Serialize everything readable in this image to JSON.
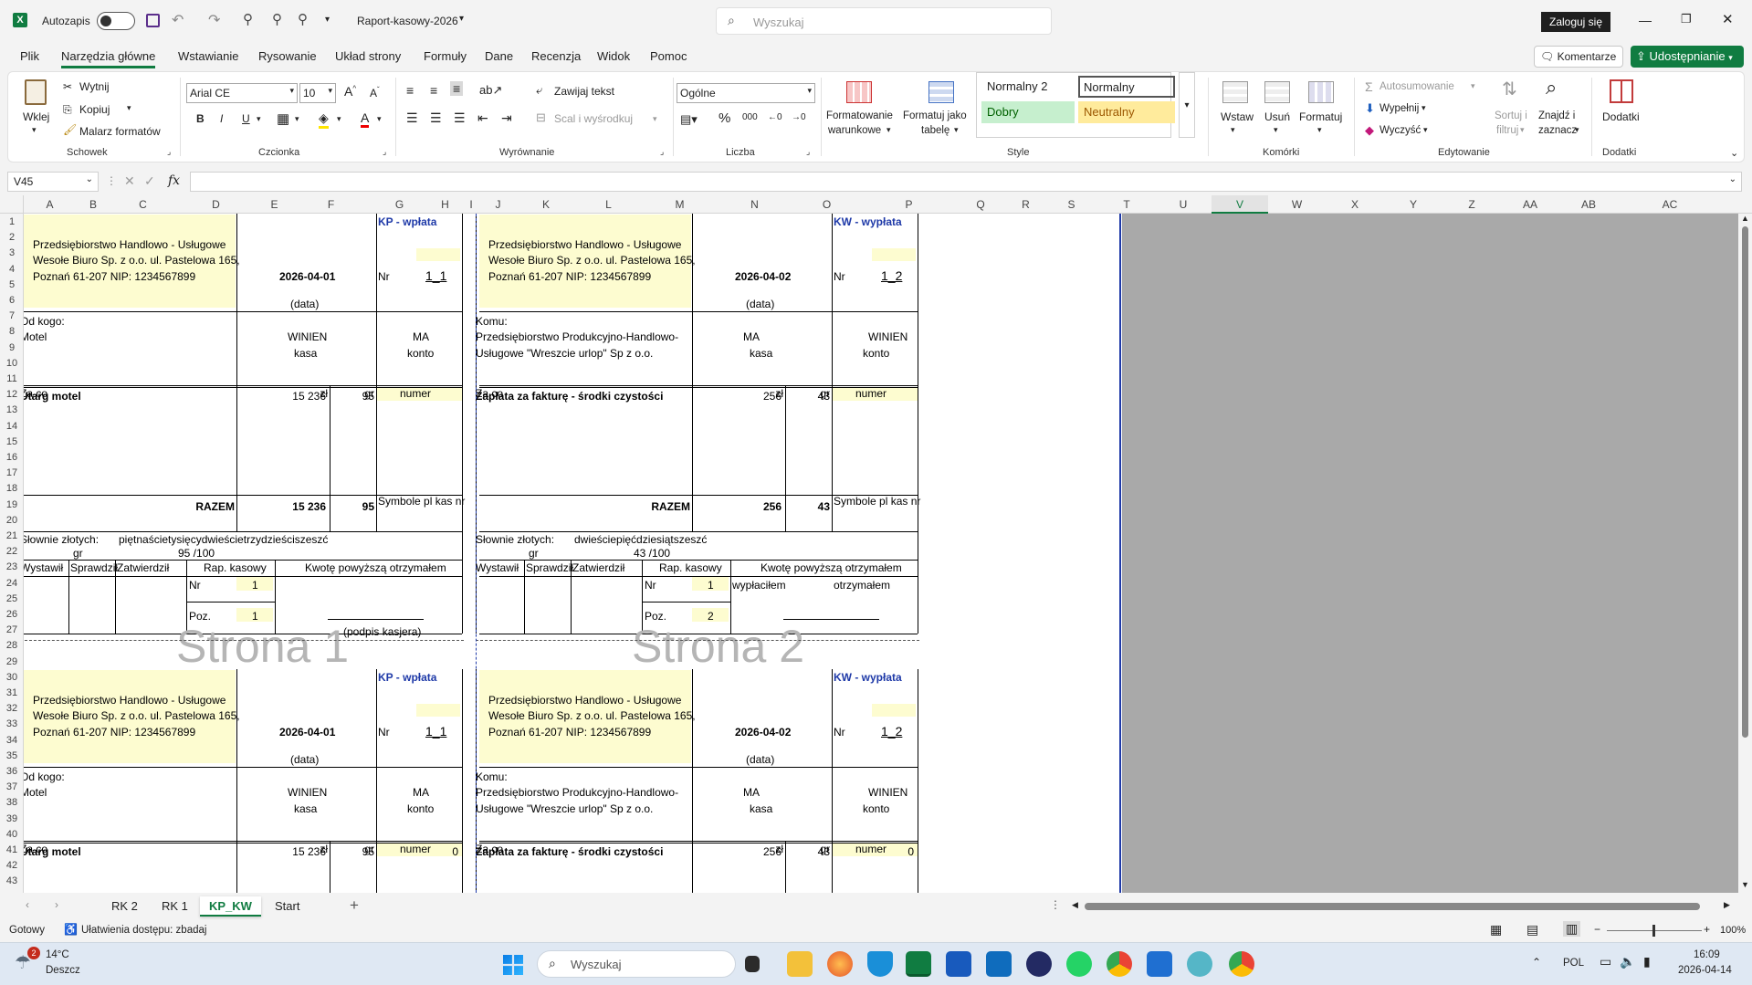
{
  "titlebar": {
    "autosave_label": "Autozapis",
    "doc_title": "Raport-kasowy-2026",
    "search_placeholder": "Wyszukaj",
    "signin_label": "Zaloguj się"
  },
  "menu": {
    "items": [
      "Plik",
      "Narzędzia główne",
      "Wstawianie",
      "Rysowanie",
      "Układ strony",
      "Formuły",
      "Dane",
      "Recenzja",
      "Widok",
      "Pomoc"
    ],
    "active": "Narzędzia główne",
    "comments_label": "Komentarze",
    "share_label": "Udostępnianie"
  },
  "ribbon": {
    "clipboard": {
      "paste": "Wklej",
      "cut": "Wytnij",
      "copy": "Kopiuj",
      "painter": "Malarz formatów",
      "group": "Schowek"
    },
    "font": {
      "name": "Arial CE",
      "size": "10",
      "group": "Czcionka",
      "bold": "B",
      "italic": "I",
      "underline": "U"
    },
    "alignment": {
      "wrap": "Zawijaj tekst",
      "merge": "Scal i wyśrodkuj",
      "group": "Wyrównanie"
    },
    "number": {
      "format": "Ogólne",
      "percent": "%",
      "thousands": "000",
      "group": "Liczba"
    },
    "styles": {
      "cond_format_1": "Formatowanie",
      "cond_format_2": "warunkowe",
      "table_1": "Formatuj jako",
      "table_2": "tabelę",
      "normal2": "Normalny 2",
      "normal": "Normalny",
      "good": "Dobry",
      "neutral": "Neutralny",
      "group": "Style"
    },
    "cells": {
      "insert": "Wstaw",
      "delete": "Usuń",
      "format": "Formatuj",
      "group": "Komórki"
    },
    "editing": {
      "autosum": "Autosumowanie",
      "fill": "Wypełnij",
      "clear": "Wyczyść",
      "sort_1": "Sortuj i",
      "sort_2": "filtruj",
      "find_1": "Znajdź i",
      "find_2": "zaznacz",
      "group": "Edytowanie"
    },
    "addins": {
      "label": "Dodatki",
      "group": "Dodatki"
    }
  },
  "formula_bar": {
    "name_box": "V45",
    "fx": "fx",
    "value": ""
  },
  "columns": [
    "A",
    "B",
    "C",
    "D",
    "E",
    "F",
    "G",
    "H",
    "I",
    "J",
    "K",
    "L",
    "M",
    "N",
    "O",
    "P",
    "Q",
    "R",
    "S",
    "T",
    "U",
    "V",
    "W",
    "X",
    "Y",
    "Z",
    "AA",
    "AB",
    "AC",
    "A"
  ],
  "rows": [
    "1",
    "2",
    "3",
    "4",
    "5",
    "6",
    "7",
    "8",
    "9",
    "10",
    "11",
    "12",
    "13",
    "14",
    "15",
    "16",
    "17",
    "18",
    "19",
    "20",
    "21",
    "22",
    "23",
    "24",
    "25",
    "26",
    "27",
    "28",
    "29",
    "30",
    "31",
    "32",
    "33",
    "34",
    "35",
    "36",
    "37",
    "38",
    "39",
    "40",
    "41",
    "42",
    "43"
  ],
  "vouchers": {
    "kp": {
      "company_1": "Przedsiębiorstwo Handlowo - Usługowe",
      "company_2": "Wesołe Biuro Sp. z o.o. ul. Pastelowa 165,",
      "company_3": "Poznań 61-207 NIP: 1234567899",
      "date": "2026-04-01",
      "date_label": "(data)",
      "type": "KP - wpłata",
      "nr_label": "Nr",
      "nr_value": "1_1",
      "party_label": "Od kogo:",
      "party_1": "Motel",
      "party_2": "",
      "debit_1": "WINIEN",
      "debit_2": "kasa",
      "credit_1": "MA",
      "credit_2": "konto",
      "zaco": "Za co",
      "zl": "zł",
      "gr": "gr",
      "numer": "numer",
      "item": "Utarg motel",
      "item_zl": "15 236",
      "item_gr": "95",
      "razem": "RAZEM",
      "total_zl": "15 236",
      "total_gr": "95",
      "symbole": "Symbole pl kas nr",
      "slownie_label": "Słownie złotych:",
      "slownie": "piętnaścietysięcydwieścietrzydzieściszeszć",
      "slownie_gr_label": "gr",
      "slownie_gr": "95 /100",
      "wystawil": "Wystawił",
      "sprawdzil": "Sprawdził",
      "zatwierdzil": "Zatwierdził",
      "rap_kasowy": "Rap. kasowy",
      "kwote": "Kwotę powyższą otrzymałem",
      "rap_nr_label": "Nr",
      "rap_nr": "1",
      "poz_label": "Poz.",
      "poz": "1",
      "sign_1": "",
      "sign_2": "",
      "podpis": "(podpis kasjera)",
      "watermark": "Strona 1",
      "nr_zero": "0"
    },
    "kw": {
      "company_1": "Przedsiębiorstwo Handlowo - Usługowe",
      "company_2": "Wesołe Biuro Sp. z o.o. ul. Pastelowa 165,",
      "company_3": "Poznań 61-207 NIP: 1234567899",
      "date": "2026-04-02",
      "date_label": "(data)",
      "type": "KW - wypłata",
      "nr_label": "Nr",
      "nr_value": "1_2",
      "party_label": "Komu:",
      "party_1": "Przedsiębiorstwo Produkcyjno-Handlowo-",
      "party_2": "Usługowe \"Wreszcie urlop\" Sp z o.o.",
      "debit_1": "MA",
      "debit_2": "kasa",
      "credit_1": "WINIEN",
      "credit_2": "konto",
      "zaco": "Za co",
      "zl": "zł",
      "gr": "gr",
      "numer": "numer",
      "item": "Zapłata za fakturę - środki czystości",
      "item_zl": "256",
      "item_gr": "43",
      "razem": "RAZEM",
      "total_zl": "256",
      "total_gr": "43",
      "symbole": "Symbole pl kas nr",
      "slownie_label": "Słownie złotych:",
      "slownie": "dwieściepięćdziesiątszeszć",
      "slownie_gr_label": "gr",
      "slownie_gr": "43 /100",
      "wystawil": "Wystawił",
      "sprawdzil": "Sprawdził",
      "zatwierdzil": "Zatwierdził",
      "rap_kasowy": "Rap. kasowy",
      "kwote": "Kwotę powyższą otrzymałem",
      "rap_nr_label": "Nr",
      "rap_nr": "1",
      "poz_label": "Poz.",
      "poz": "2",
      "sign_1": "wypłaciłem",
      "sign_2": "otrzymałem",
      "podpis": "",
      "watermark": "Strona 2",
      "nr_zero": "0"
    }
  },
  "sheet_tabs": [
    "RK 2",
    "RK 1",
    "KP_KW",
    "Start"
  ],
  "active_tab": "KP_KW",
  "statusbar": {
    "ready": "Gotowy",
    "accessibility": "Ułatwienia dostępu: zbadaj",
    "zoom": "100%"
  },
  "taskbar": {
    "weather_temp": "14°C",
    "weather_desc": "Deszcz",
    "weather_badge": "2",
    "search": "Wyszukaj",
    "lang": "POL",
    "time": "16:09",
    "date": "2026-04-14"
  }
}
